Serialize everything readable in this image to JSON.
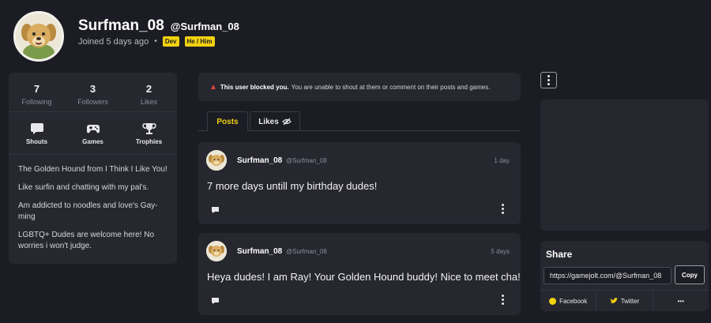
{
  "profile": {
    "display_name": "Surfman_08",
    "username": "@Surfman_08",
    "joined": "Joined 5 days ago",
    "tags": [
      "Dev",
      "He / Him"
    ]
  },
  "stats": [
    {
      "value": "7",
      "label": "Following"
    },
    {
      "value": "3",
      "label": "Followers"
    },
    {
      "value": "2",
      "label": "Likes"
    }
  ],
  "nav": [
    {
      "label": "Shouts",
      "icon": "chat-bubble-icon"
    },
    {
      "label": "Games",
      "icon": "gamepad-icon"
    },
    {
      "label": "Trophies",
      "icon": "trophy-icon"
    }
  ],
  "bio": [
    "The Golden Hound from I Think I Like You!",
    "Like surfin and chatting with my pal's.",
    "Am addicted to noodles and love's Gay-ming",
    "LGBTQ+ Dudes are welcome here! No worries i won't judge."
  ],
  "notice": {
    "bold": "This user blocked you.",
    "text": "You are unable to shout at them or comment on their posts and games."
  },
  "tabs": {
    "posts": "Posts",
    "likes": "Likes"
  },
  "posts": [
    {
      "name": "Surfman_08",
      "user": "@Surfman_08",
      "time": "1 day",
      "text": "7 more days untill my birthday dudes!"
    },
    {
      "name": "Surfman_08",
      "user": "@Surfman_08",
      "time": "5 days",
      "text": "Heya dudes! I am Ray! Your Golden Hound buddy! Nice to meet cha!"
    }
  ],
  "share": {
    "title": "Share",
    "url": "https://gamejolt.com/@Surfman_08",
    "copy": "Copy",
    "facebook": "Facebook",
    "twitter": "Twitter",
    "more": "•••"
  },
  "colors": {
    "accent": "#f2d20f",
    "background": "#1c1d24",
    "card": "#26272f",
    "warning": "#e0453a"
  }
}
